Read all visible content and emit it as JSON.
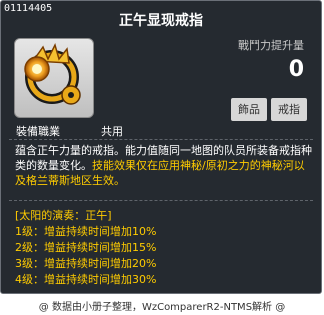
{
  "item": {
    "id": "01114405",
    "name": "正午显现戒指",
    "icon": "golden-sun-ring-icon"
  },
  "stats": {
    "power_label": "戰鬥力提升量",
    "power_value": "0"
  },
  "tags": [
    "飾品",
    "戒指"
  ],
  "job": {
    "label": "裝備職業",
    "value": "共用"
  },
  "description": {
    "part1": "蕴含正午力量的戒指。能力值随同一地图的队员所装备戒指种类的数量变化。",
    "part2": "技能效果仅在应用神秘/原初之力的神秘河以及格兰蒂斯地区生效。"
  },
  "set_effect": {
    "title": "[太阳的演奏：正午]",
    "levels": [
      "1级：增益持续时间增加10%",
      "2级：增益持续时间增加15%",
      "3级：增益持续时间增加20%",
      "4级：增益持续时间增加30%"
    ]
  },
  "footer": "@ 数据由小册子整理，WzComparerR2-NTMS解析 @",
  "colors": {
    "background": "#252a30",
    "highlight": "#ffcc00",
    "text": "#ffffff"
  }
}
